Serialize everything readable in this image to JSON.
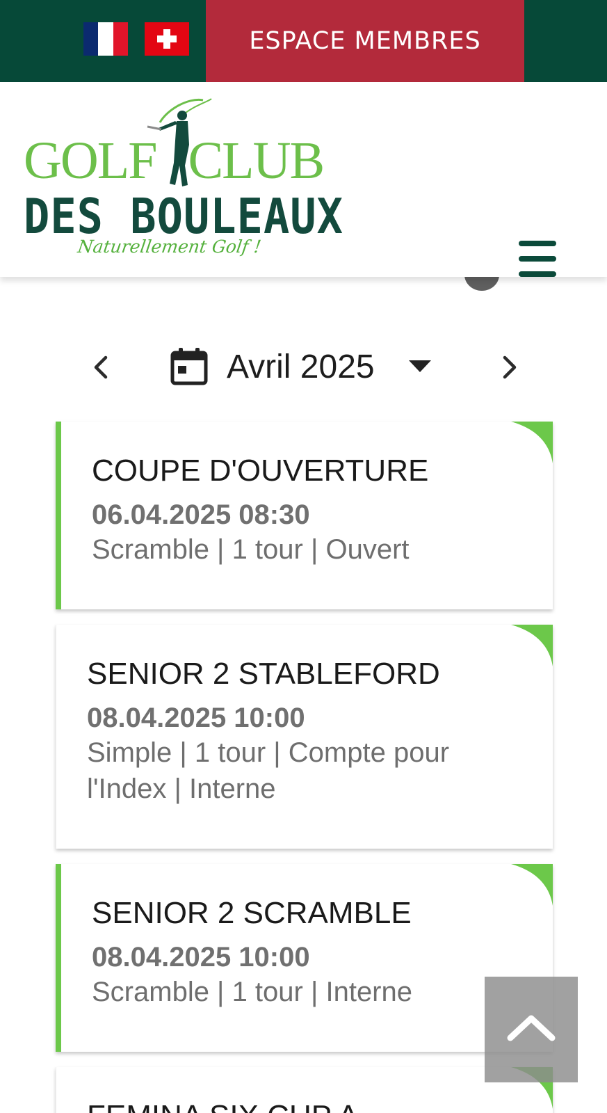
{
  "topbar": {
    "languages": [
      {
        "name": "french",
        "colors": [
          "#0b2a6f",
          "#ffffff",
          "#e1152a"
        ]
      },
      {
        "name": "swiss",
        "colors": [
          "#e30613",
          "#ffffff"
        ]
      }
    ],
    "members_label": "ESPACE MEMBRES",
    "bg_color": "#064938",
    "members_color": "#b32a3b"
  },
  "header": {
    "logo": {
      "line1a": "GOLF",
      "line1b": "CLUB",
      "line2": "DES BOULEAUX",
      "tagline": "Naturellement Golf !"
    },
    "menu_icon": "hamburger-menu-icon"
  },
  "calendar": {
    "month_label": "Avril 2025",
    "prev_icon": "chevron-left-icon",
    "next_icon": "chevron-right-icon",
    "calendar_icon": "calendar-icon",
    "dropdown_icon": "caret-down-icon"
  },
  "events": [
    {
      "title": "COUPE D'OUVERTURE",
      "date": "06.04.2025 08:30",
      "desc": "Scramble | 1 tour | Ouvert",
      "highlight": true
    },
    {
      "title": "SENIOR 2 STABLEFORD",
      "date": "08.04.2025 10:00",
      "desc": "Simple | 1 tour | Compte pour l'Index | Interne",
      "highlight": false
    },
    {
      "title": "SENIOR 2 SCRAMBLE",
      "date": "08.04.2025 10:00",
      "desc": "Scramble | 1 tour | Interne",
      "highlight": true
    },
    {
      "title": "FEMINA SIX CUP A",
      "date": "",
      "desc": "",
      "highlight": false
    }
  ],
  "colors": {
    "accent_green": "#6cc84a",
    "dark_green": "#0b4a3a"
  },
  "back_to_top_icon": "chevron-up-icon"
}
